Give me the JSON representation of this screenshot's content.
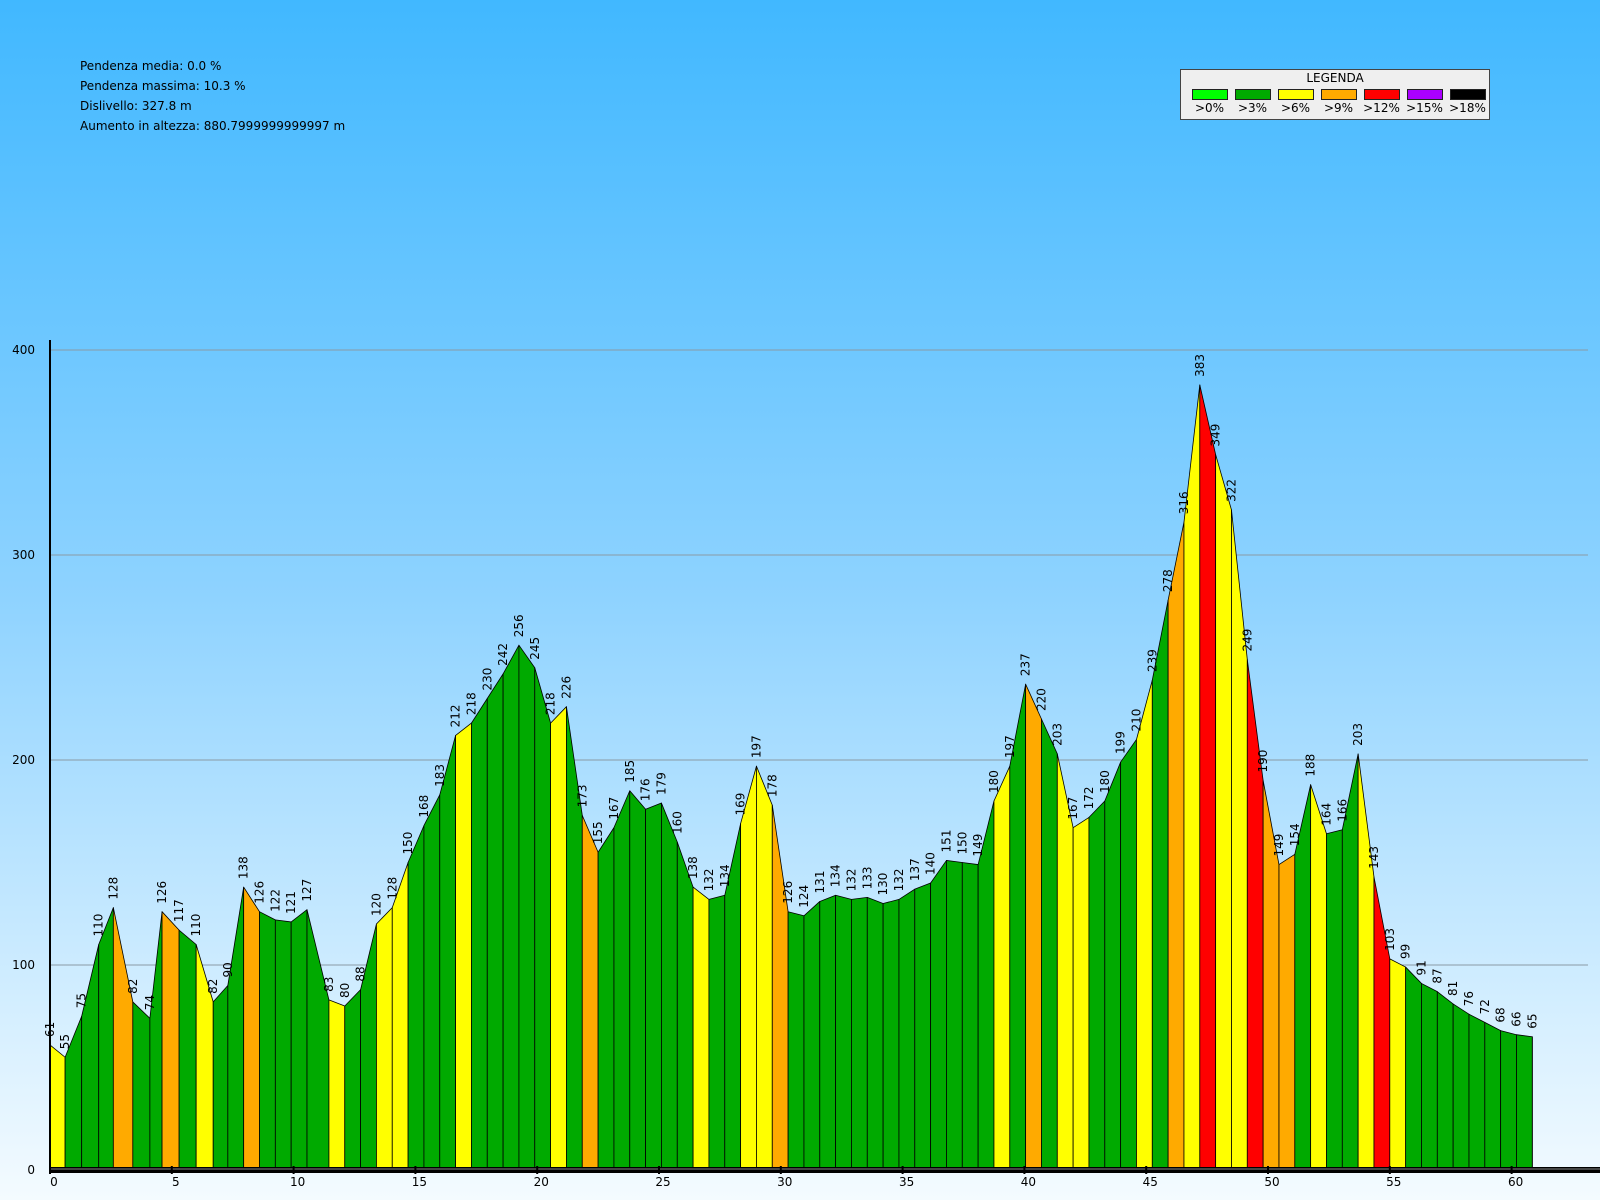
{
  "stats": {
    "pendenza_media": "Pendenza media: 0.0 %",
    "pendenza_massima": "Pendenza massima: 10.3 %",
    "dislivello": "Dislivello: 327.8 m",
    "aumento": "Aumento in altezza: 880.7999999999997 m"
  },
  "legend": {
    "title": "LEGENDA",
    "items": [
      {
        "label": ">0%",
        "color": "#00ff00"
      },
      {
        "label": ">3%",
        "color": "#00aa00"
      },
      {
        "label": ">6%",
        "color": "#ffff00"
      },
      {
        "label": ">9%",
        "color": "#ffaa00"
      },
      {
        "label": ">12%",
        "color": "#ff0000"
      },
      {
        "label": ">15%",
        "color": "#aa00ff"
      },
      {
        "label": ">18%",
        "color": "#000000"
      }
    ]
  },
  "chart_data": {
    "type": "area",
    "xlabel": "",
    "ylabel": "",
    "xlim": [
      0,
      63.3
    ],
    "ylim": [
      0,
      400
    ],
    "x_ticks": [
      0,
      5,
      10,
      15,
      20,
      25,
      30,
      35,
      40,
      45,
      50,
      55,
      60
    ],
    "y_ticks": [
      0,
      100,
      200,
      300,
      400
    ],
    "grid": true,
    "legend_position": "top-right",
    "x": [
      0,
      0.62,
      1.3,
      2,
      2.6,
      3.4,
      4.1,
      4.6,
      5.3,
      6,
      6.7,
      7.3,
      7.95,
      8.6,
      9.25,
      9.9,
      10.55,
      11.45,
      12.1,
      12.75,
      13.4,
      14.05,
      14.7,
      15.35,
      16,
      16.65,
      17.3,
      17.95,
      18.6,
      19.25,
      19.9,
      20.55,
      21.2,
      21.85,
      22.5,
      23.15,
      23.8,
      24.45,
      25.1,
      25.75,
      26.4,
      27.05,
      27.7,
      28.35,
      29,
      29.65,
      30.3,
      30.95,
      31.6,
      32.25,
      32.9,
      33.55,
      34.2,
      34.85,
      35.5,
      36.15,
      36.8,
      37.45,
      38.1,
      38.75,
      39.4,
      40.05,
      40.7,
      41.35,
      42,
      42.65,
      43.3,
      43.95,
      44.6,
      45.25,
      45.9,
      46.55,
      47.2,
      47.85,
      48.5,
      49.15,
      49.8,
      50.45,
      51.1,
      51.75,
      52.4,
      53.05,
      53.7,
      54.35,
      55,
      55.65,
      56.3,
      56.95,
      57.6,
      58.25,
      58.9,
      59.55,
      60.2,
      60.85,
      61.5,
      62.15,
      62.75,
      63.3
    ],
    "elevation": [
      61,
      55,
      75,
      110,
      128,
      82,
      74,
      126,
      117,
      110,
      82,
      90,
      138,
      126,
      122,
      121,
      127,
      83,
      80,
      88,
      120,
      128,
      150,
      168,
      183,
      212,
      218,
      230,
      242,
      256,
      245,
      218,
      226,
      173,
      155,
      167,
      185,
      176,
      179,
      160,
      138,
      132,
      134,
      169,
      197,
      178,
      126,
      124,
      131,
      134,
      132,
      133,
      130,
      132,
      137,
      140,
      151,
      150,
      149,
      180,
      197,
      237,
      220,
      203,
      167,
      172,
      180,
      199,
      210,
      239,
      278,
      316,
      383,
      349,
      322,
      249,
      190,
      149,
      154,
      188,
      164,
      166,
      203,
      143,
      103,
      99,
      91,
      87,
      81,
      76,
      72,
      68,
      66,
      65
    ],
    "segment_gradient_class": [
      2,
      1,
      1,
      1,
      3,
      1,
      1,
      3,
      1,
      2,
      1,
      1,
      3,
      1,
      1,
      1,
      1,
      2,
      1,
      1,
      2,
      2,
      1,
      1,
      1,
      2,
      1,
      1,
      1,
      1,
      1,
      2,
      1,
      3,
      1,
      1,
      1,
      1,
      1,
      1,
      2,
      1,
      1,
      2,
      2,
      3,
      1,
      1,
      1,
      1,
      1,
      1,
      1,
      1,
      1,
      1,
      1,
      1,
      1,
      2,
      1,
      3,
      1,
      2,
      2,
      1,
      1,
      1,
      2,
      1,
      3,
      2,
      4,
      2,
      2,
      4,
      3,
      3,
      1,
      2,
      1,
      1,
      2,
      4,
      2,
      1,
      1,
      1,
      1,
      1,
      1,
      1,
      1,
      1
    ]
  }
}
